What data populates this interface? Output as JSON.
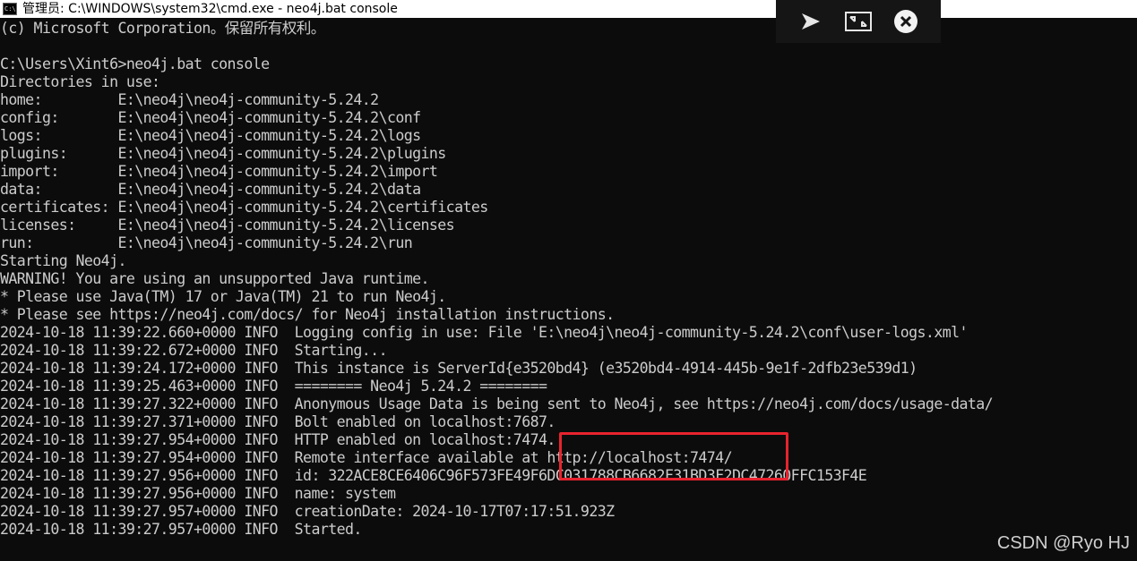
{
  "window": {
    "title": "管理员: C:\\WINDOWS\\system32\\cmd.exe - neo4j.bat  console"
  },
  "overlay": {
    "icons": [
      "send-play-icon",
      "restore-window-icon",
      "close-circle-icon"
    ]
  },
  "terminal": {
    "lines": [
      "(c) Microsoft Corporation。保留所有权利。",
      "",
      "C:\\Users\\Xint6>neo4j.bat console",
      "Directories in use:",
      "home:         E:\\neo4j\\neo4j-community-5.24.2",
      "config:       E:\\neo4j\\neo4j-community-5.24.2\\conf",
      "logs:         E:\\neo4j\\neo4j-community-5.24.2\\logs",
      "plugins:      E:\\neo4j\\neo4j-community-5.24.2\\plugins",
      "import:       E:\\neo4j\\neo4j-community-5.24.2\\import",
      "data:         E:\\neo4j\\neo4j-community-5.24.2\\data",
      "certificates: E:\\neo4j\\neo4j-community-5.24.2\\certificates",
      "licenses:     E:\\neo4j\\neo4j-community-5.24.2\\licenses",
      "run:          E:\\neo4j\\neo4j-community-5.24.2\\run",
      "Starting Neo4j.",
      "WARNING! You are using an unsupported Java runtime.",
      "* Please use Java(TM) 17 or Java(TM) 21 to run Neo4j.",
      "* Please see https://neo4j.com/docs/ for Neo4j installation instructions.",
      "2024-10-18 11:39:22.660+0000 INFO  Logging config in use: File 'E:\\neo4j\\neo4j-community-5.24.2\\conf\\user-logs.xml'",
      "2024-10-18 11:39:22.672+0000 INFO  Starting...",
      "2024-10-18 11:39:24.172+0000 INFO  This instance is ServerId{e3520bd4} (e3520bd4-4914-445b-9e1f-2dfb23e539d1)",
      "2024-10-18 11:39:25.463+0000 INFO  ======== Neo4j 5.24.2 ========",
      "2024-10-18 11:39:27.322+0000 INFO  Anonymous Usage Data is being sent to Neo4j, see https://neo4j.com/docs/usage-data/",
      "2024-10-18 11:39:27.371+0000 INFO  Bolt enabled on localhost:7687.",
      "2024-10-18 11:39:27.954+0000 INFO  HTTP enabled on localhost:7474.",
      "2024-10-18 11:39:27.954+0000 INFO  Remote interface available at http://localhost:7474/",
      "2024-10-18 11:39:27.956+0000 INFO  id: 322ACE8CE6406C96F573FE49F6DC031788CB6682F31BD3F2DC47260FFC153F4E",
      "2024-10-18 11:39:27.956+0000 INFO  name: system",
      "2024-10-18 11:39:27.957+0000 INFO  creationDate: 2024-10-17T07:17:51.923Z",
      "2024-10-18 11:39:27.957+0000 INFO  Started."
    ]
  },
  "watermark": "CSDN @Ryo HJ",
  "colors": {
    "background": "#0c0c0c",
    "text": "#cccccc",
    "highlight": "#e8232e"
  }
}
